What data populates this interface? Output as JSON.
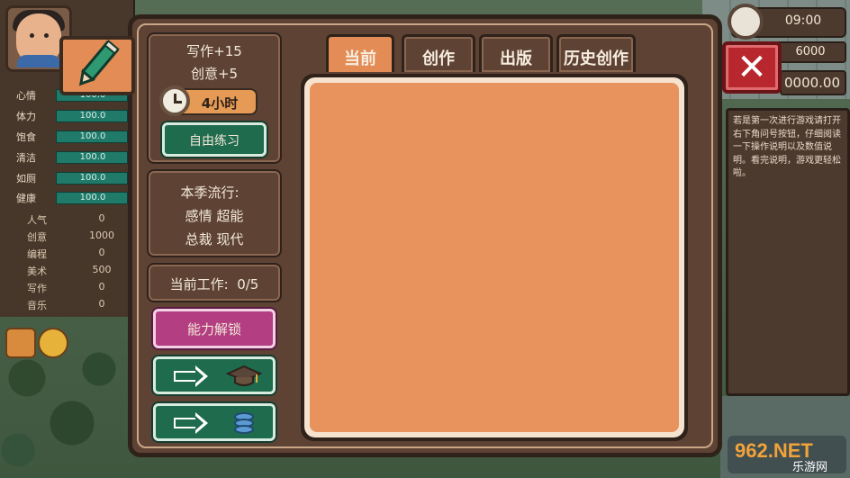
{
  "stats": [
    {
      "label": "心情",
      "value": "100.0"
    },
    {
      "label": "体力",
      "value": "100.0"
    },
    {
      "label": "饱食",
      "value": "100.0"
    },
    {
      "label": "清洁",
      "value": "100.0"
    },
    {
      "label": "如厕",
      "value": "100.0"
    },
    {
      "label": "健康",
      "value": "100.0"
    }
  ],
  "attributes": [
    {
      "label": "人气",
      "value": "0"
    },
    {
      "label": "创意",
      "value": "1000"
    },
    {
      "label": "编程",
      "value": "0"
    },
    {
      "label": "美术",
      "value": "500"
    },
    {
      "label": "写作",
      "value": "0"
    },
    {
      "label": "音乐",
      "value": "0"
    }
  ],
  "top_right": {
    "clock": "09:00",
    "money": "6000",
    "money2": "0000.00",
    "close_label": "✕"
  },
  "tip": {
    "text": "若是第一次进行游戏请打开右下角问号按钮，仔细阅读一下操作说明以及数值说明。看完说明，游戏更轻松啦。"
  },
  "skill": {
    "line1": "写作+15",
    "line2": "创意+5",
    "duration": "4小时",
    "practice_label": "自由练习"
  },
  "trend": {
    "title": "本季流行:",
    "line1": "感情 超能",
    "line2": "总裁 现代"
  },
  "work": {
    "label": "当前工作:  0/5"
  },
  "buttons": {
    "unlock_label": "能力解锁"
  },
  "tabs": [
    {
      "label": "当前",
      "active": true
    },
    {
      "label": "创作",
      "active": false
    },
    {
      "label": "出版",
      "active": false
    },
    {
      "label": "历史创作",
      "active": false
    }
  ],
  "watermark": {
    "brand": "962.NET",
    "sub": "乐游网"
  },
  "colors": {
    "panel_brown": "#5e4335",
    "accent_orange": "#e38c56",
    "button_green": "#1f6b4e",
    "button_pink": "#b33f82",
    "close_red": "#b7272d"
  }
}
